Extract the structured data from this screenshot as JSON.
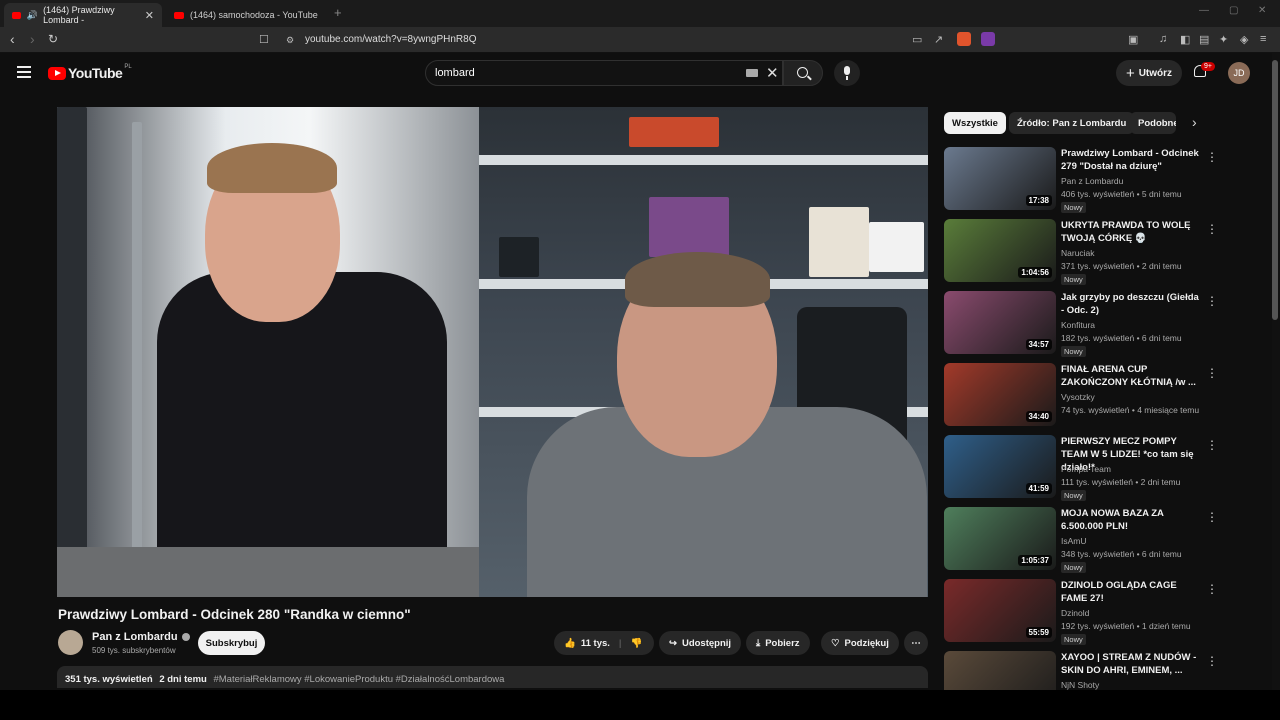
{
  "browser": {
    "tabs": [
      {
        "label": "(1464) Prawdziwy Lombard -",
        "active": true
      },
      {
        "label": "(1464) samochodoza - YouTube",
        "active": false
      }
    ],
    "url": "youtube.com/watch?v=8ywngPHnR8Q"
  },
  "header": {
    "logo": "YouTube",
    "region": "PL",
    "search_query": "lombard",
    "create_label": "Utwórz",
    "notif_count": "9+",
    "avatar_initials": "JD"
  },
  "video": {
    "title": "Prawdziwy Lombard - Odcinek 280 \"Randka w ciemno\"",
    "channel": "Pan z Lombardu",
    "subscribers": "509 tys. subskrybentów",
    "subscribe_label": "Subskrybuj",
    "likes": "11 tys.",
    "share_label": "Udostępnij",
    "download_label": "Pobierz",
    "thanks_label": "Podziękuj",
    "views": "351 tys. wyświetleń",
    "date": "2 dni temu",
    "hashtags": "#MateriałReklamowy #LokowanieProduktu #DziałalnośćLombardowa"
  },
  "chips": [
    "Wszystkie",
    "Źródło: Pan z Lombardu",
    "Podobne"
  ],
  "recommendations": [
    {
      "title": "Prawdziwy Lombard - Odcinek 279 \"Dostał na dziurę\"",
      "channel": "Pan z Lombardu",
      "meta": "406 tys. wyświetleń • 5 dni temu",
      "badge": "Nowy",
      "duration": "17:38",
      "color": "#6b7a8f"
    },
    {
      "title": "UKRYTA PRAWDA TO WOLĘ TWOJĄ CÓRKĘ 💀",
      "channel": "Naruciak",
      "meta": "371 tys. wyświetleń • 2 dni temu",
      "badge": "Nowy",
      "duration": "1:04:56",
      "color": "#5a7d3a"
    },
    {
      "title": "Jak grzyby po deszczu (Giełda - Odc. 2)",
      "channel": "Konfitura",
      "meta": "182 tys. wyświetleń • 6 dni temu",
      "badge": "Nowy",
      "duration": "34:57",
      "color": "#8a4b6e"
    },
    {
      "title": "FINAŁ ARENA CUP ZAKOŃCZONY KŁÓTNIĄ /w ...",
      "channel": "Vysotzky",
      "meta": "74 tys. wyświetleń • 4 miesiące temu",
      "badge": "",
      "duration": "34:40",
      "color": "#a33a2a"
    },
    {
      "title": "PIERWSZY MECZ POMPY TEAM W 5 LIDZE! *co tam się działo!*",
      "channel": "Pompa Team",
      "meta": "111 tys. wyświetleń • 2 dni temu",
      "badge": "Nowy",
      "duration": "41:59",
      "color": "#2f5f8a"
    },
    {
      "title": "MOJA NOWA BAZA ZA 6.500.000 PLN!",
      "channel": "IsAmU",
      "meta": "348 tys. wyświetleń • 6 dni temu",
      "badge": "Nowy",
      "duration": "1:05:37",
      "color": "#4f7f5c"
    },
    {
      "title": "DZINOLD OGLĄDA CAGE FAME 27!",
      "channel": "Dzinold",
      "meta": "192 tys. wyświetleń • 1 dzień temu",
      "badge": "Nowy",
      "duration": "55:59",
      "color": "#7a2a2a"
    },
    {
      "title": "XAYOO | STREAM Z NUDÓW - SKIN DO AHRI, EMINEM, ...",
      "channel": "NjN Shoty",
      "meta": "",
      "badge": "",
      "duration": "",
      "color": "#5a4a3a"
    }
  ]
}
